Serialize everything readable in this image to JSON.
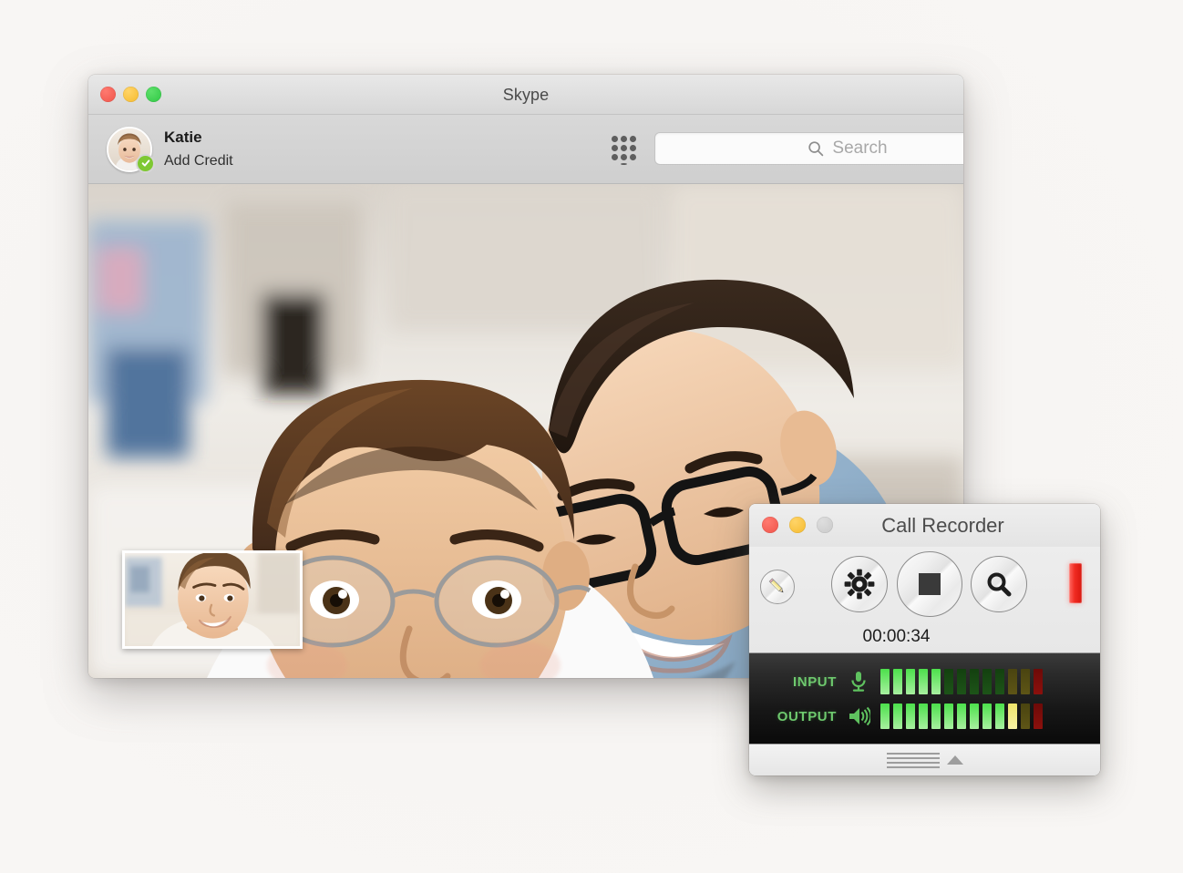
{
  "background": {
    "color": "#f6f4f2"
  },
  "skype": {
    "window_title": "Skype",
    "traffic_lights": [
      {
        "name": "close",
        "color": "#ef5349"
      },
      {
        "name": "minimize",
        "color": "#f5ba2d"
      },
      {
        "name": "zoom",
        "color": "#2fc744"
      }
    ],
    "profile": {
      "name": "Katie",
      "credit_label": "Add Credit",
      "status": "online",
      "status_icon": "checkmark-icon",
      "avatar_icon": "user-avatar-photo"
    },
    "dialpad": {
      "icon": "dialpad-icon",
      "dots": 9,
      "extra_dots": 1
    },
    "search": {
      "placeholder": "Search",
      "value": "",
      "icon": "search-icon"
    },
    "video": {
      "main_label": "video-call-main-feed",
      "pip_label": "video-call-self-preview"
    }
  },
  "recorder": {
    "window_title": "Call Recorder",
    "traffic_lights": [
      {
        "name": "close",
        "color": "#ef5349"
      },
      {
        "name": "minimize",
        "color": "#f5ba2d"
      },
      {
        "name": "zoom",
        "color": "#c9c9c9"
      }
    ],
    "toolbar": {
      "edit_icon": "pencil-icon",
      "settings_icon": "gear-icon",
      "stop_icon": "stop-square-icon",
      "browse_icon": "magnifier-icon",
      "recording_indicator": "record-level-indicator"
    },
    "timer": "00:00:34",
    "meters": {
      "input": {
        "label": "INPUT",
        "icon": "microphone-icon",
        "bars": [
          "green-on",
          "green-on",
          "green-on",
          "green-on",
          "green-on",
          "green-off",
          "green-off",
          "green-off",
          "green-off",
          "green-off",
          "yellow-off",
          "yellow-off",
          "red-off"
        ]
      },
      "output": {
        "label": "OUTPUT",
        "icon": "speaker-icon",
        "bars": [
          "green-on",
          "green-on",
          "green-on",
          "green-on",
          "green-on",
          "green-on",
          "green-on",
          "green-on",
          "green-on",
          "green-on",
          "yellow-on",
          "yellow-off",
          "red-off"
        ]
      }
    },
    "footer": {
      "grip_icon": "resize-grip-icon",
      "expand_icon": "triangle-up-icon"
    }
  }
}
